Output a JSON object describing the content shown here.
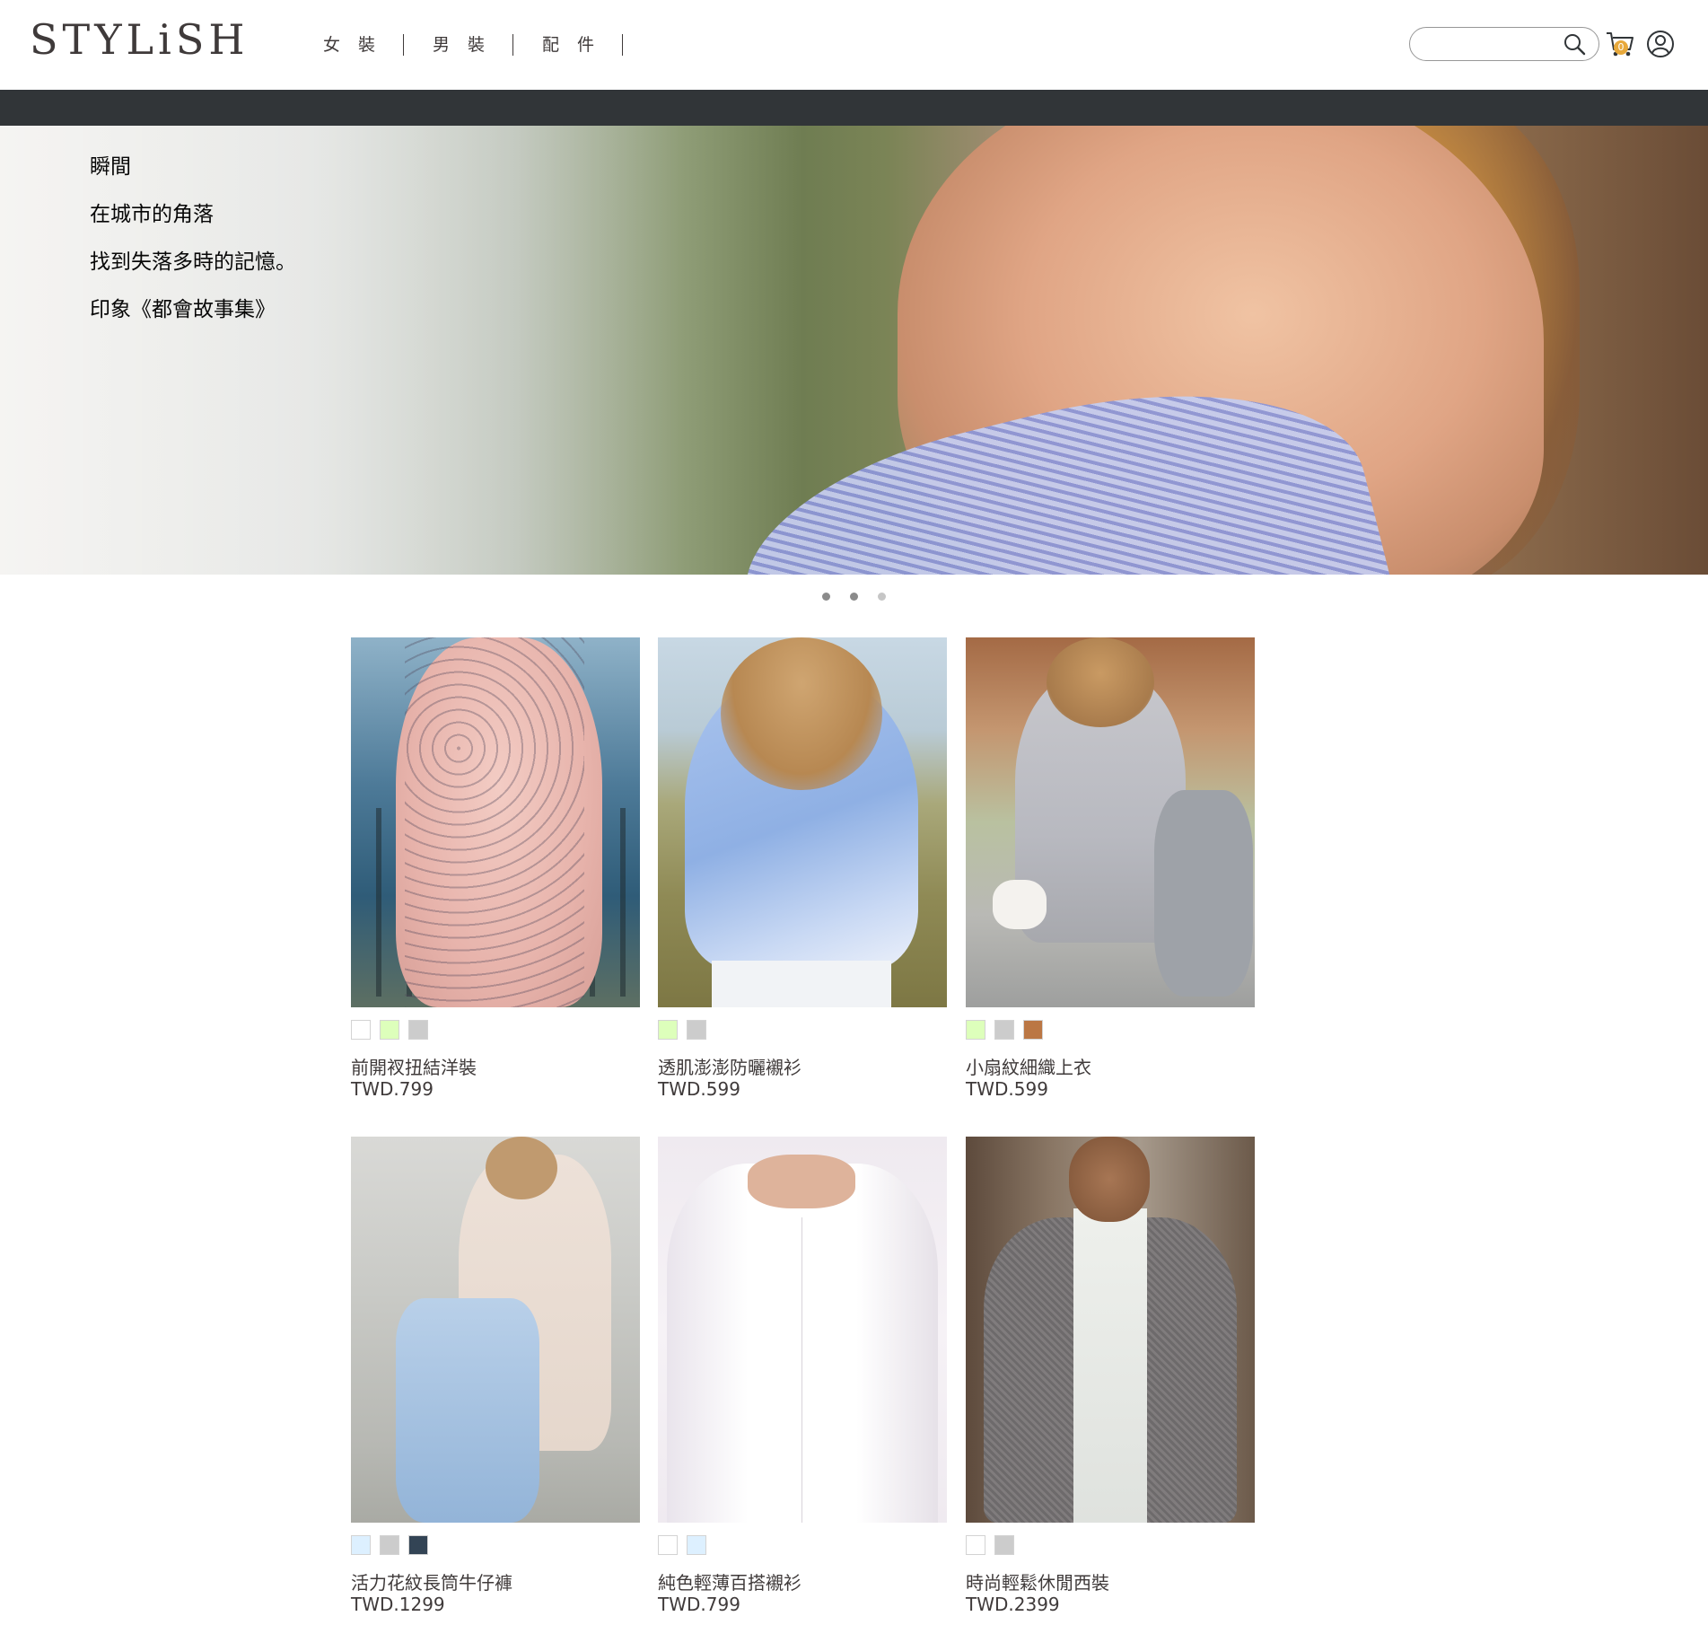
{
  "header": {
    "logo": "STYLiSH",
    "nav": [
      "女裝",
      "男裝",
      "配件"
    ],
    "search_placeholder": "",
    "cart_count": "0"
  },
  "hero": {
    "lines": [
      "瞬間",
      "在城市的角落",
      "找到失落多時的記憶。",
      "印象《都會故事集》"
    ],
    "active_slide": 1,
    "slide_count": 3
  },
  "products": [
    {
      "name": "前開衩扭結洋裝",
      "price": "TWD.799",
      "colors": [
        "#FFFFFF",
        "#DDFFBB",
        "#CCCCCC"
      ]
    },
    {
      "name": "透肌澎澎防曬襯衫",
      "price": "TWD.599",
      "colors": [
        "#DDFFBB",
        "#CCCCCC"
      ]
    },
    {
      "name": "小扇紋細織上衣",
      "price": "TWD.599",
      "colors": [
        "#DDFFBB",
        "#CCCCCC",
        "#BB7744"
      ]
    },
    {
      "name": "活力花紋長筒牛仔褲",
      "price": "TWD.1299",
      "colors": [
        "#DDF0FF",
        "#CCCCCC",
        "#334455"
      ]
    },
    {
      "name": "純色輕薄百搭襯衫",
      "price": "TWD.799",
      "colors": [
        "#FFFFFF",
        "#DDF0FF"
      ]
    },
    {
      "name": "時尚輕鬆休閒西裝",
      "price": "TWD.2399",
      "colors": [
        "#FFFFFF",
        "#CCCCCC"
      ]
    }
  ]
}
